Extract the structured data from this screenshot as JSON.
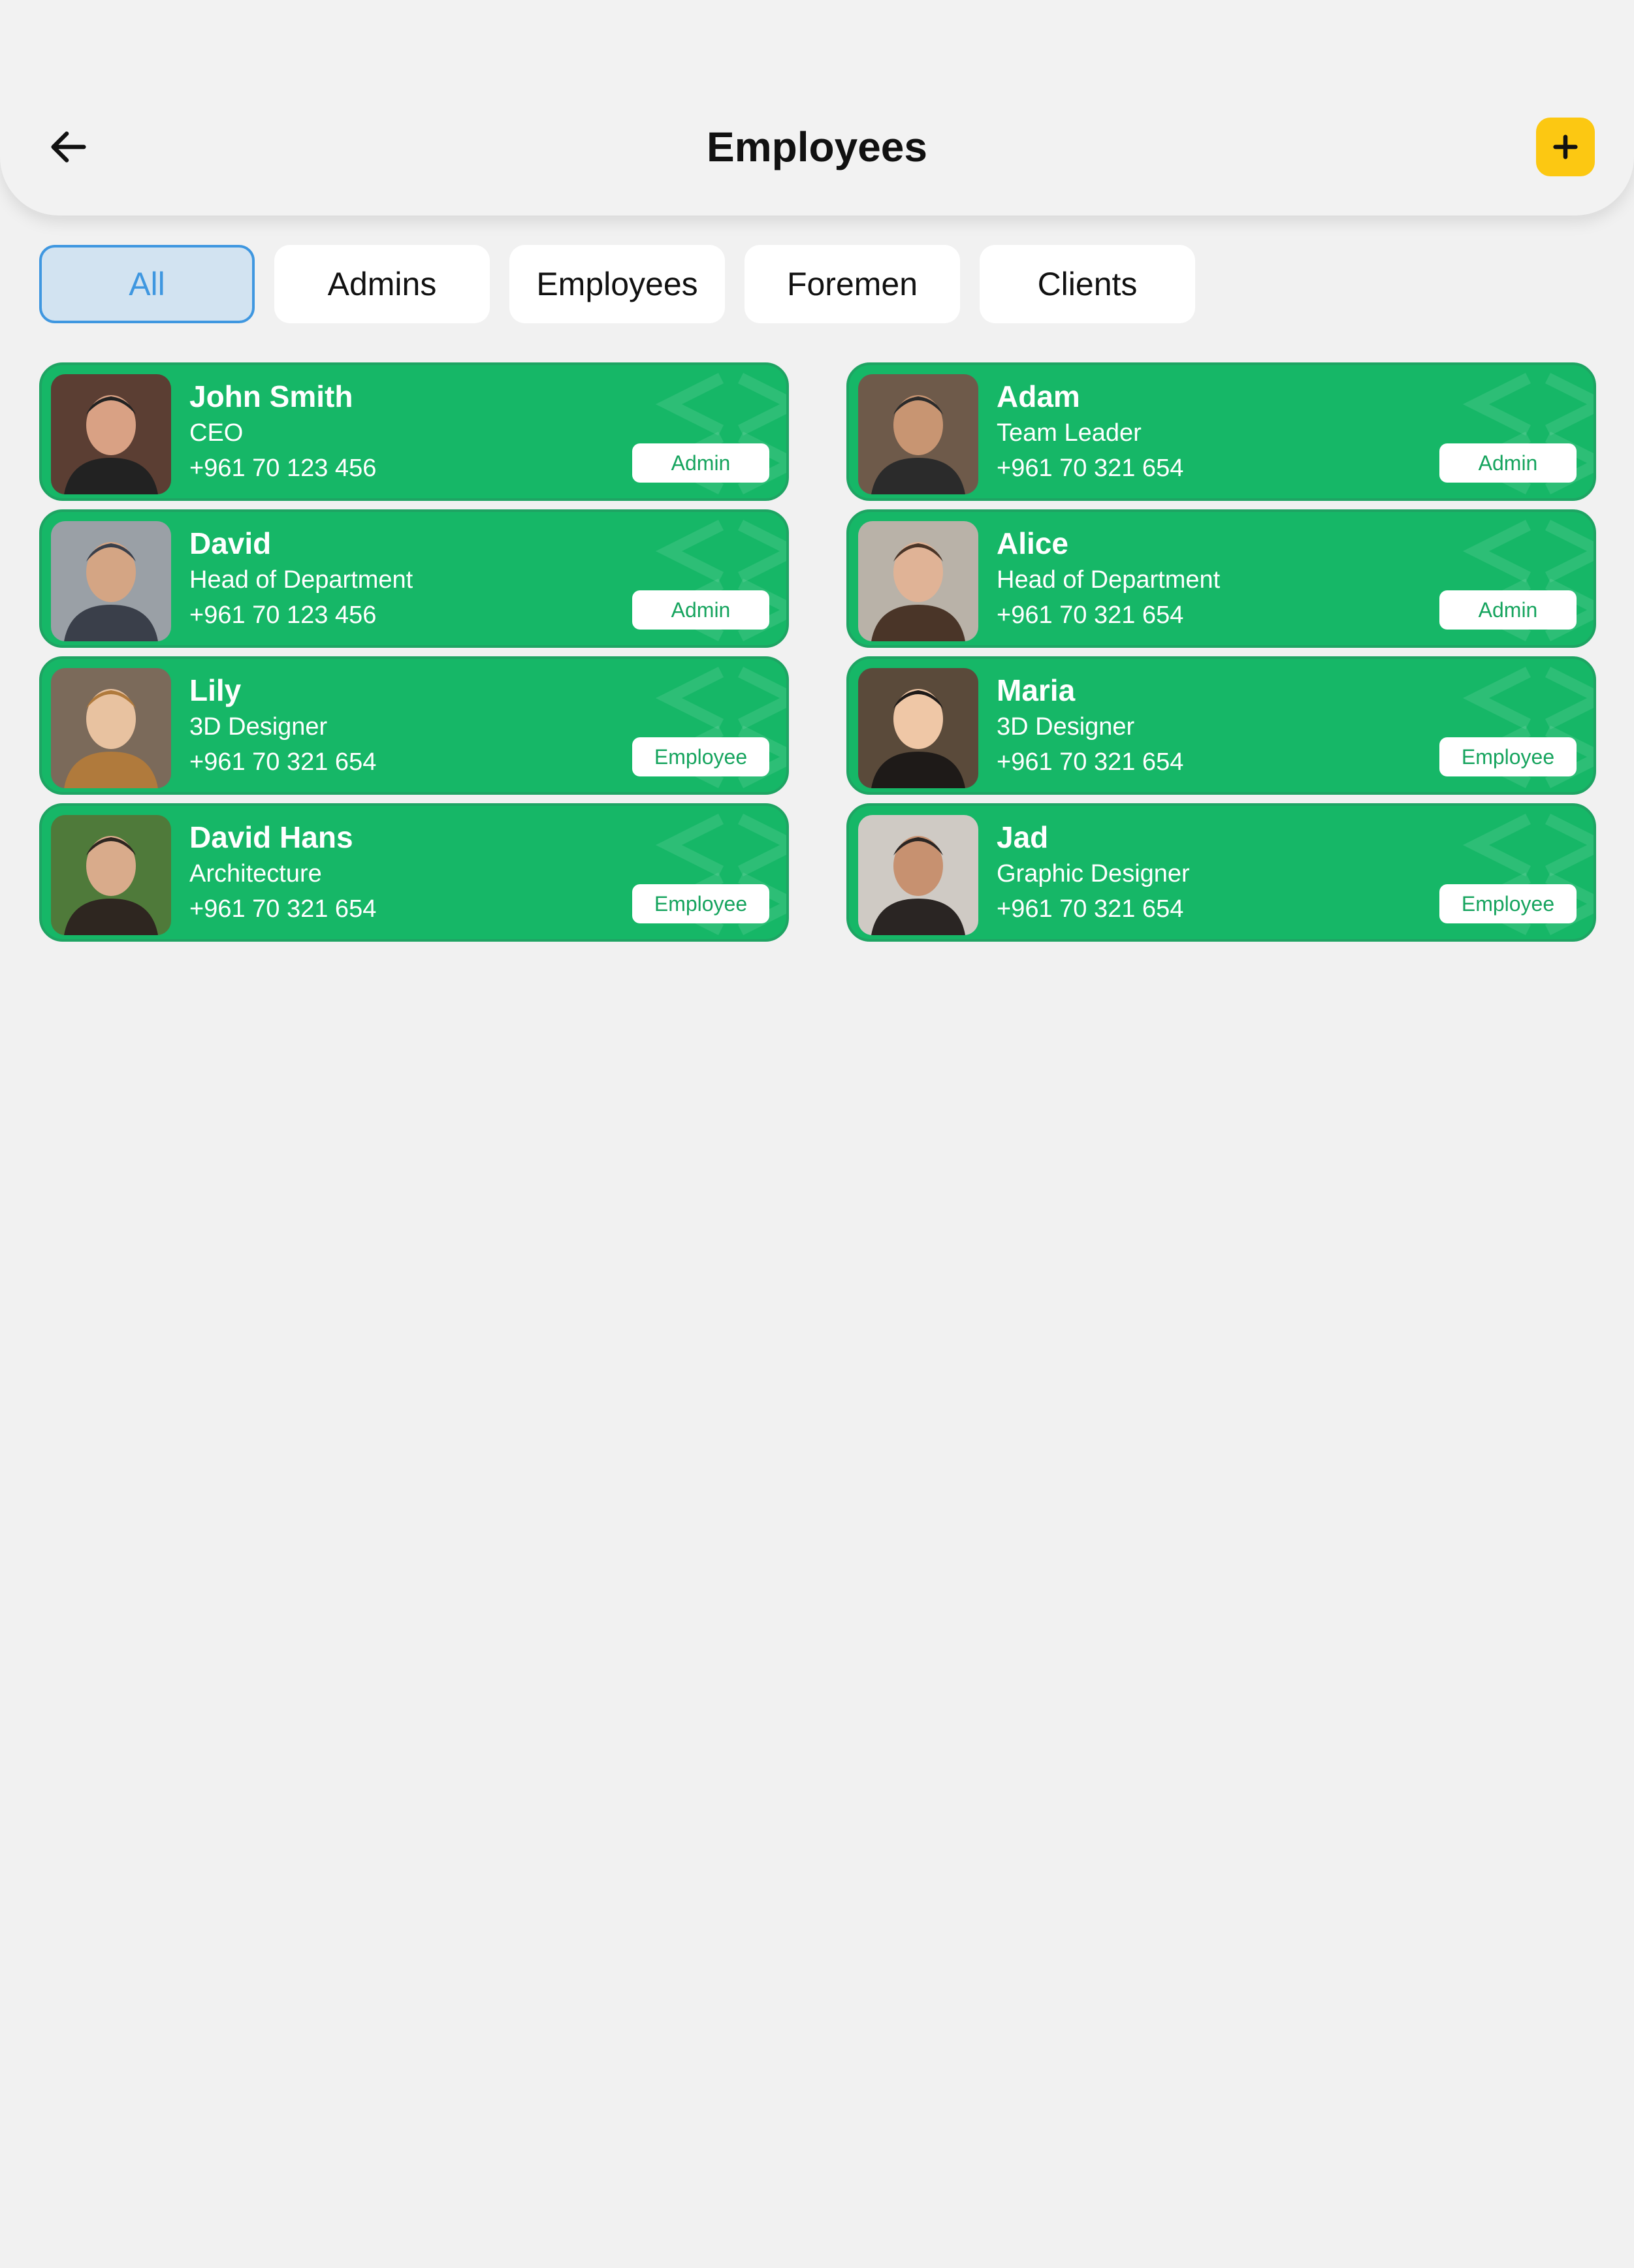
{
  "header": {
    "title": "Employees"
  },
  "tabs": [
    {
      "label": "All",
      "active": true
    },
    {
      "label": "Admins",
      "active": false
    },
    {
      "label": "Employees",
      "active": false
    },
    {
      "label": "Foremen",
      "active": false
    },
    {
      "label": "Clients",
      "active": false
    }
  ],
  "employees": [
    {
      "name": "John Smith",
      "title": "CEO",
      "phone": "+961 70 123 456",
      "role": "Admin"
    },
    {
      "name": "Adam",
      "title": "Team Leader",
      "phone": "+961 70 321 654",
      "role": "Admin"
    },
    {
      "name": "David",
      "title": "Head of Department",
      "phone": "+961 70 123 456",
      "role": "Admin"
    },
    {
      "name": "Alice",
      "title": "Head of Department",
      "phone": "+961 70 321 654",
      "role": "Admin"
    },
    {
      "name": "Lily",
      "title": "3D Designer",
      "phone": "+961 70 321 654",
      "role": "Employee"
    },
    {
      "name": "Maria",
      "title": "3D Designer",
      "phone": "+961 70 321 654",
      "role": "Employee"
    },
    {
      "name": "David Hans",
      "title": "Architecture",
      "phone": "+961 70 321 654",
      "role": "Employee"
    },
    {
      "name": "Jad",
      "title": "Graphic Designer",
      "phone": "+961 70 321 654",
      "role": "Employee"
    }
  ],
  "colors": {
    "background": "#f1f1f1",
    "card_green": "#16b767",
    "accent_yellow": "#fcc812",
    "active_tab_blue": "#3f97e0",
    "active_tab_bg": "#d2e3f1"
  },
  "icons": {
    "back": "arrow-left-icon",
    "add": "plus-icon",
    "card_decoration": "code-brackets-watermark"
  }
}
